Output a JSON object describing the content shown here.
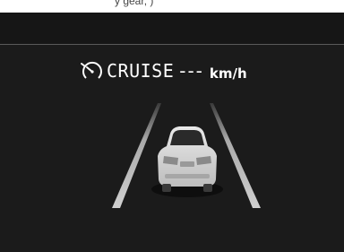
{
  "caption": "y gear,     )",
  "cruise": {
    "label": "CRUISE",
    "speed_value": "---",
    "speed_unit": "km/h",
    "icon": "cruise-control-gauge-icon"
  },
  "graphic": {
    "vehicle": "car-rear-view-icon",
    "lanes": "lane-lines"
  },
  "colors": {
    "display_background": "#1b1b1b",
    "text": "#ffffff",
    "lane": "#c8c8c8"
  }
}
